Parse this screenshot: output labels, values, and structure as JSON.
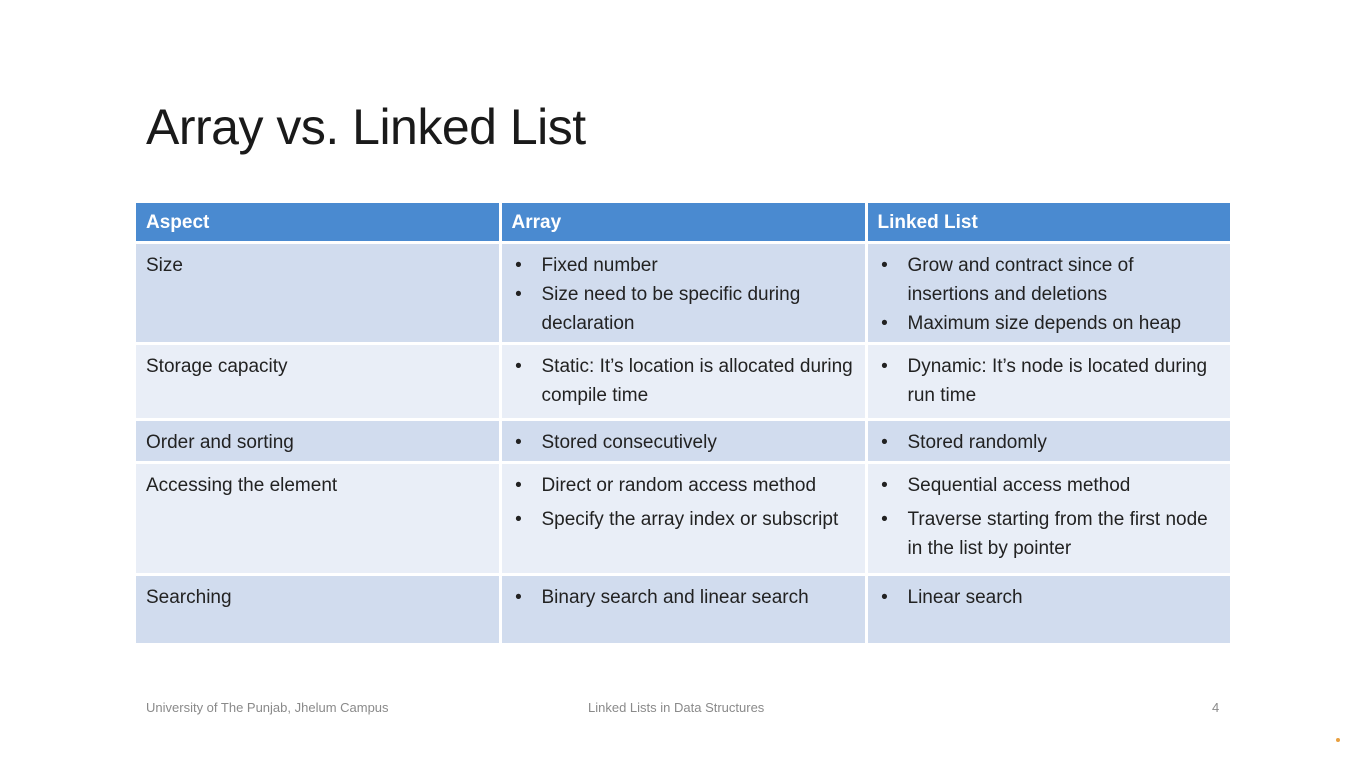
{
  "title": "Array vs. Linked List",
  "table": {
    "headers": [
      "Aspect",
      "Array",
      "Linked List"
    ],
    "rows": [
      {
        "aspect": "Size",
        "array": [
          "Fixed number",
          "Size need to be specific during declaration"
        ],
        "linked_list": [
          "Grow and contract since of insertions and deletions",
          "Maximum size depends on heap"
        ]
      },
      {
        "aspect": "Storage capacity",
        "array": [
          "Static: It’s location is allocated during compile time"
        ],
        "linked_list": [
          "Dynamic: It’s node is located during run time"
        ]
      },
      {
        "aspect": "Order and sorting",
        "array": [
          "Stored consecutively"
        ],
        "linked_list": [
          "Stored randomly"
        ]
      },
      {
        "aspect": "Accessing the element",
        "array": [
          "Direct or random access method",
          "Specify the array index or subscript"
        ],
        "linked_list": [
          "Sequential access method",
          "Traverse starting from the first node in the list by pointer"
        ]
      },
      {
        "aspect": "Searching",
        "array": [
          "Binary search and linear search"
        ],
        "linked_list": [
          "Linear search"
        ]
      }
    ]
  },
  "bullet_char": "•",
  "footer": {
    "left": "University of The Punjab, Jhelum Campus",
    "center": "Linked Lists in Data Structures",
    "page_number": "4"
  },
  "colors": {
    "header_bg": "#4a8ad0",
    "row_dark": "#d1dcee",
    "row_light": "#e9eef7"
  }
}
